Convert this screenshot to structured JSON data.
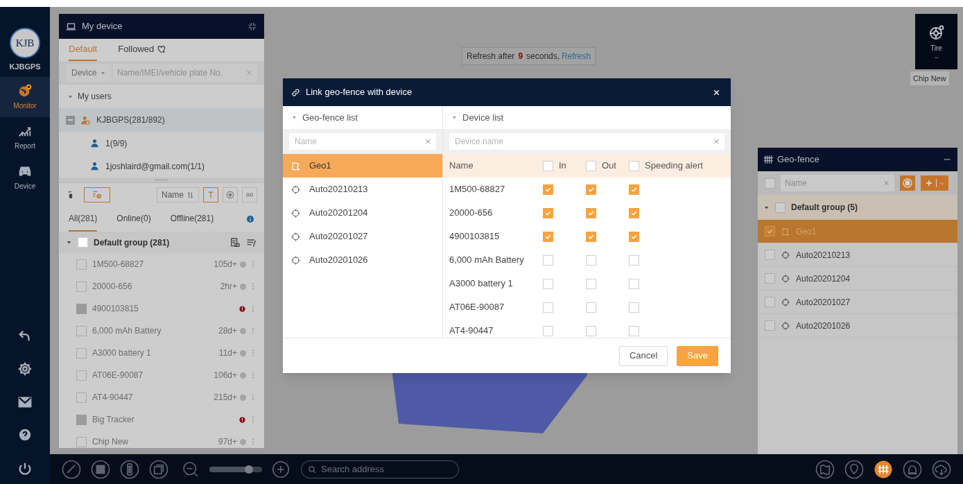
{
  "brand": {
    "logo": "KJB",
    "name": "KJBGPS"
  },
  "nav": [
    {
      "label": "Monitor",
      "selected": true
    },
    {
      "label": "Report",
      "selected": false
    },
    {
      "label": "Device",
      "selected": false
    }
  ],
  "device_panel": {
    "title": "My device",
    "tabs": [
      {
        "label": "Default",
        "selected": true
      },
      {
        "label": "Followed",
        "selected": false
      }
    ],
    "search": {
      "type": "Device",
      "placeholder": "Name/IMEI/vehicle plate No."
    },
    "users": {
      "label": "My users",
      "expanded": true,
      "items": [
        {
          "label": "KJBGPS(281/892)",
          "kind": "admin",
          "selected": true,
          "children": [
            {
              "label": "1(9/9)"
            },
            {
              "label": "1joshlaird@gmail.com(1/1)"
            }
          ]
        }
      ]
    },
    "sort": "Name",
    "filters": [
      {
        "label": "All(281)",
        "selected": true
      },
      {
        "label": "Online(0)",
        "selected": false
      },
      {
        "label": "Offline(281)",
        "selected": false
      }
    ],
    "group": {
      "label": "Default group (281)",
      "expanded": true,
      "checked": false,
      "devices": [
        {
          "name": "1M500-68827",
          "time": "105d+",
          "kind": "offline"
        },
        {
          "name": "20000-656",
          "time": "2hr+",
          "kind": "offline"
        },
        {
          "name": "4900103815",
          "kind": "alarm"
        },
        {
          "name": "6,000 mAh Battery",
          "time": "28d+",
          "kind": "offline"
        },
        {
          "name": "A3000 battery 1",
          "time": "11d+",
          "kind": "offline"
        },
        {
          "name": "AT06E-90087",
          "time": "106d+",
          "kind": "offline"
        },
        {
          "name": "AT4-90447",
          "time": "215d+",
          "kind": "offline"
        },
        {
          "name": "Big Tracker",
          "kind": "alarm"
        },
        {
          "name": "Chip New",
          "time": "97d+",
          "kind": "offline"
        }
      ]
    }
  },
  "refresh": {
    "prefix": "Refresh after",
    "seconds": "9",
    "suffix": "seconds,",
    "link": "Refresh"
  },
  "tire_widget": {
    "label": "Tire",
    "tooltip": "Chip New"
  },
  "geofence_panel": {
    "title": "Geo-fence",
    "placeholder": "Name",
    "select_all": false,
    "group": {
      "label": "Default group (5)",
      "expanded": true,
      "checked": false,
      "items": [
        {
          "name": "Geo1",
          "kind": "polygon",
          "checked": true,
          "selected": true
        },
        {
          "name": "Auto20210213",
          "kind": "circle",
          "checked": false,
          "selected": false
        },
        {
          "name": "Auto20201204",
          "kind": "circle",
          "checked": false,
          "selected": false
        },
        {
          "name": "Auto20201027",
          "kind": "circle",
          "checked": false,
          "selected": false
        },
        {
          "name": "Auto20201026",
          "kind": "circle",
          "checked": false,
          "selected": false
        }
      ]
    }
  },
  "modal": {
    "title": "Link geo-fence with device",
    "geofence_list": {
      "heading": "Geo-fence list",
      "placeholder": "Name",
      "items": [
        {
          "name": "Geo1",
          "kind": "polygon",
          "selected": true
        },
        {
          "name": "Auto20210213",
          "kind": "circle",
          "selected": false
        },
        {
          "name": "Auto20201204",
          "kind": "circle",
          "selected": false
        },
        {
          "name": "Auto20201027",
          "kind": "circle",
          "selected": false
        },
        {
          "name": "Auto20201026",
          "kind": "circle",
          "selected": false
        }
      ]
    },
    "device_list": {
      "heading": "Device list",
      "placeholder": "Device name",
      "columns": [
        {
          "label": "Name"
        },
        {
          "label": "In",
          "checked": false
        },
        {
          "label": "Out",
          "checked": false
        },
        {
          "label": "Speeding alert",
          "checked": false
        }
      ],
      "rows": [
        {
          "name": "1M500-68827",
          "in": true,
          "out": true,
          "speeding": true
        },
        {
          "name": "20000-656",
          "in": true,
          "out": true,
          "speeding": true
        },
        {
          "name": "4900103815",
          "in": true,
          "out": true,
          "speeding": true
        },
        {
          "name": "6,000 mAh Battery",
          "in": false,
          "out": false,
          "speeding": false
        },
        {
          "name": "A3000 battery 1",
          "in": false,
          "out": false,
          "speeding": false
        },
        {
          "name": "AT06E-90087",
          "in": false,
          "out": false,
          "speeding": false
        },
        {
          "name": "AT4-90447",
          "in": false,
          "out": false,
          "speeding": false
        }
      ]
    },
    "buttons": [
      {
        "label": "Cancel",
        "kind": "secondary"
      },
      {
        "label": "Save",
        "kind": "primary"
      }
    ]
  },
  "bottom_bar": {
    "zoom": {
      "level": 0.75
    },
    "search_placeholder": "Search address"
  }
}
